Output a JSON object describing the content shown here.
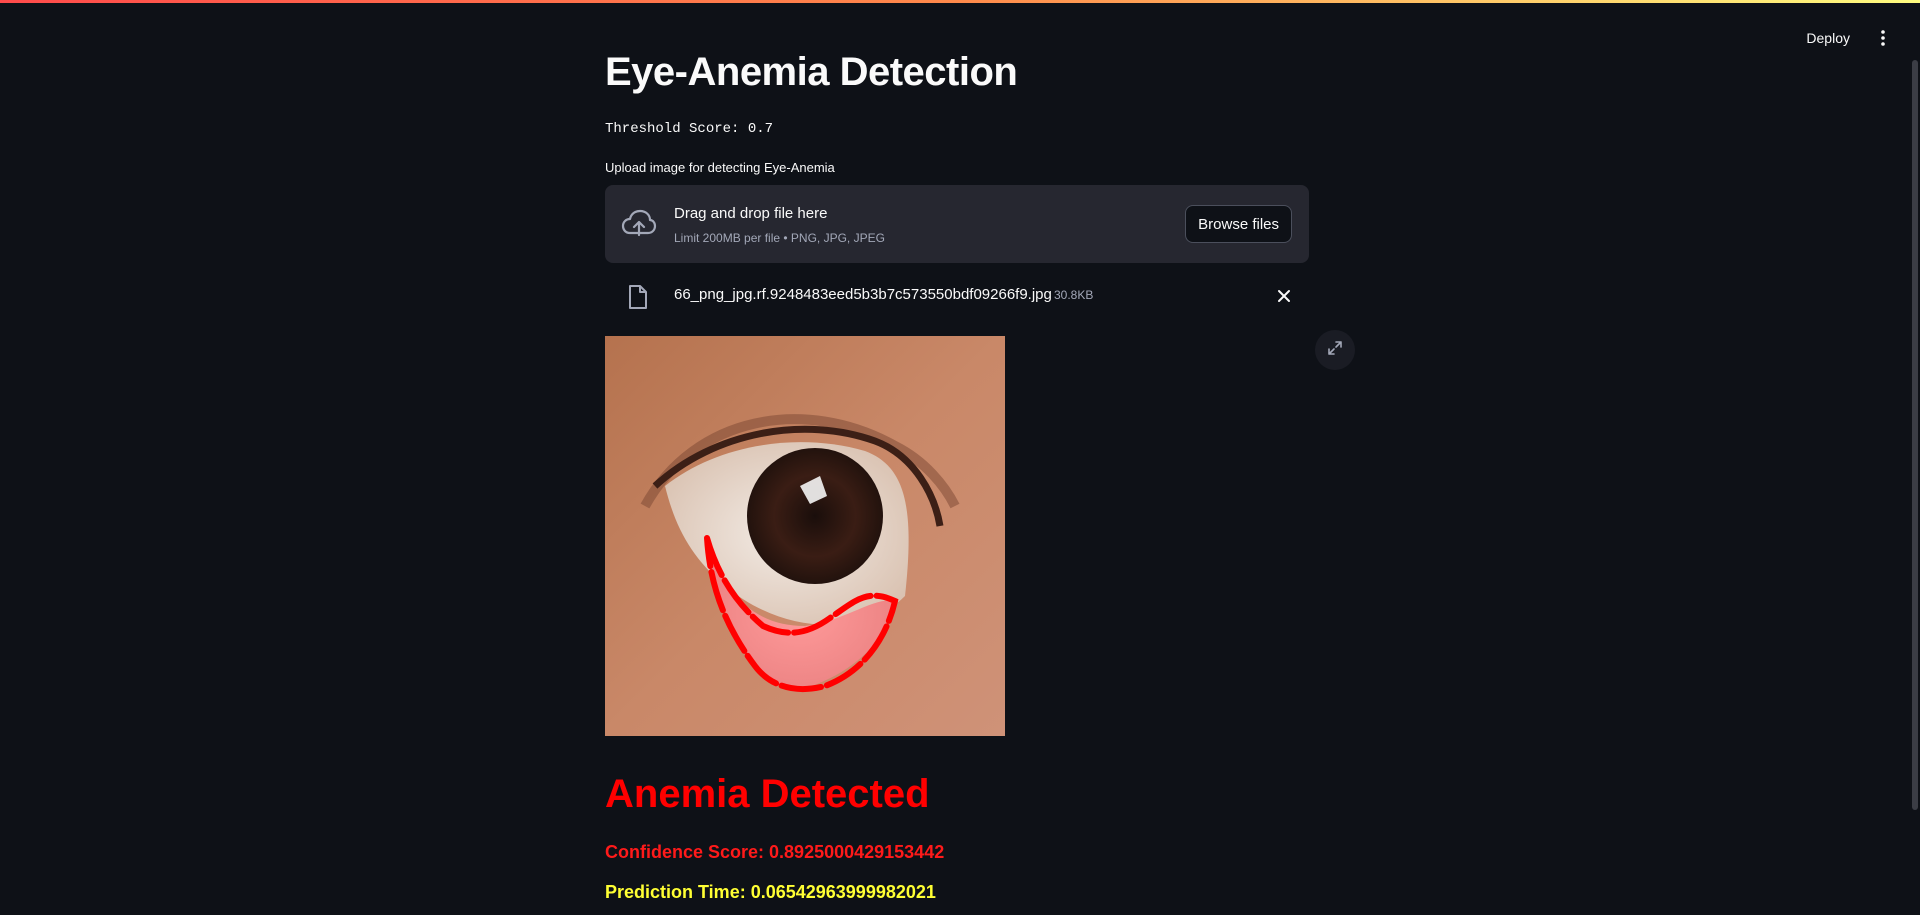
{
  "header": {
    "deploy_label": "Deploy",
    "menu_icon": "more-vertical-icon"
  },
  "app": {
    "title": "Eye-Anemia Detection",
    "threshold_text": "Threshold Score: 0.7"
  },
  "uploader": {
    "label": "Upload image for detecting Eye-Anemia",
    "drop_title": "Drag and drop file here",
    "drop_limit": "Limit 200MB per file • PNG, JPG, JPEG",
    "browse_label": "Browse files",
    "cloud_icon": "cloud-upload-icon"
  },
  "file": {
    "name": "66_png_jpg.rf.9248483eed5b3b7c573550bdf09266f9.jpg",
    "size": "30.8KB",
    "file_icon": "file-icon",
    "remove_icon": "close-icon"
  },
  "image": {
    "expand_icon": "fullscreen-expand-icon"
  },
  "result": {
    "status": "Anemia Detected",
    "confidence": "Confidence Score: 0.8925000429153442",
    "prediction_time": "Prediction Time: 0.06542963999982021"
  },
  "colors": {
    "background": "#0e1117",
    "dropzone": "#262730",
    "result_red": "#ff0000",
    "time_yellow": "#ffff33"
  }
}
